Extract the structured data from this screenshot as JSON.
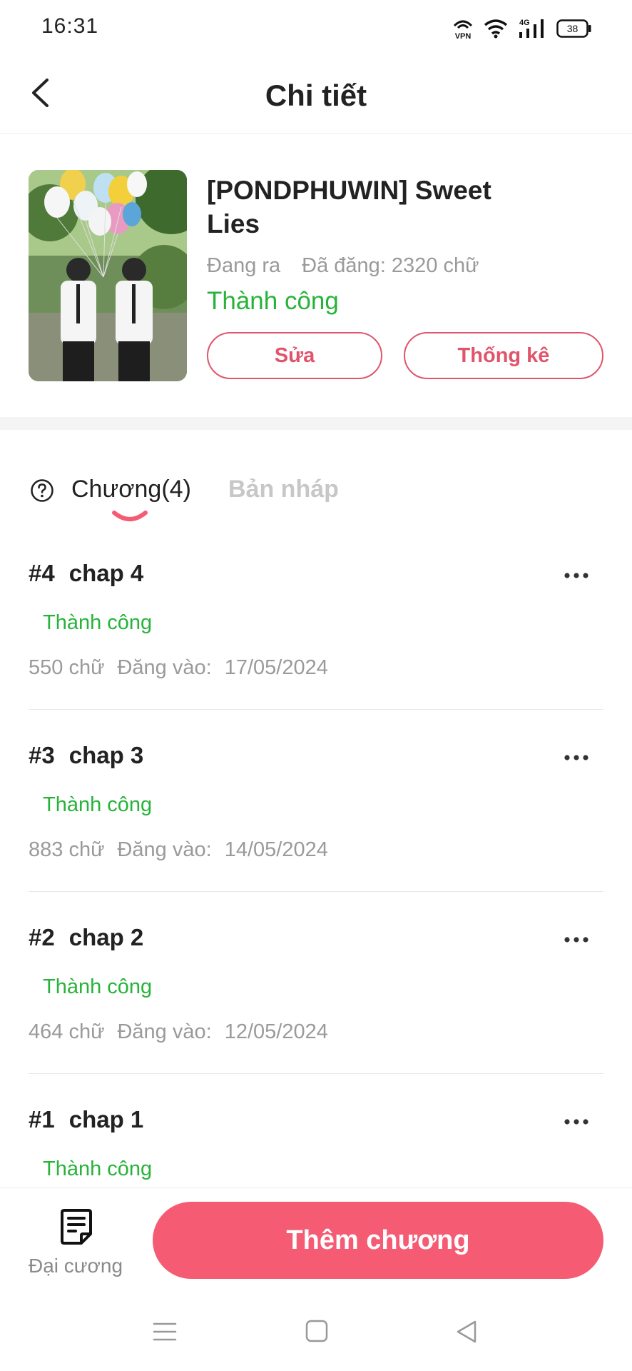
{
  "status_bar": {
    "time": "16:31",
    "vpn_label": "VPN",
    "network_label": "4G",
    "battery": "38"
  },
  "header": {
    "title": "Chi tiết"
  },
  "book": {
    "title": "[PONDPHUWIN] Sweet Lies",
    "state": "Đang ra",
    "word_count": "Đã đăng: 2320 chữ",
    "status": "Thành công",
    "edit_label": "Sửa",
    "stats_label": "Thống kê"
  },
  "tabs": {
    "chapters": "Chương(4)",
    "drafts": "Bản nháp"
  },
  "chapters": [
    {
      "num": "#4",
      "name": "chap 4",
      "status": "Thành công",
      "words": "550 chữ",
      "posted_label": "Đăng vào:",
      "date": "17/05/2024"
    },
    {
      "num": "#3",
      "name": "chap 3",
      "status": "Thành công",
      "words": "883 chữ",
      "posted_label": "Đăng vào:",
      "date": "14/05/2024"
    },
    {
      "num": "#2",
      "name": "chap 2",
      "status": "Thành công",
      "words": "464 chữ",
      "posted_label": "Đăng vào:",
      "date": "12/05/2024"
    },
    {
      "num": "#1",
      "name": "chap 1",
      "status": "Thành công"
    }
  ],
  "bottom": {
    "outline_label": "Đại cương",
    "add_chapter_label": "Thêm chương"
  },
  "colors": {
    "accent": "#f55b72",
    "accent_text": "#e0546c",
    "success": "#27b33a",
    "muted": "#9a9a9a"
  },
  "icons": {
    "back": "chevron-left-icon",
    "help": "question-circle-icon",
    "more": "more-horizontal-icon",
    "outline": "document-icon",
    "nav_menu": "menu-icon",
    "nav_home": "home-square-icon",
    "nav_back": "triangle-back-icon"
  }
}
